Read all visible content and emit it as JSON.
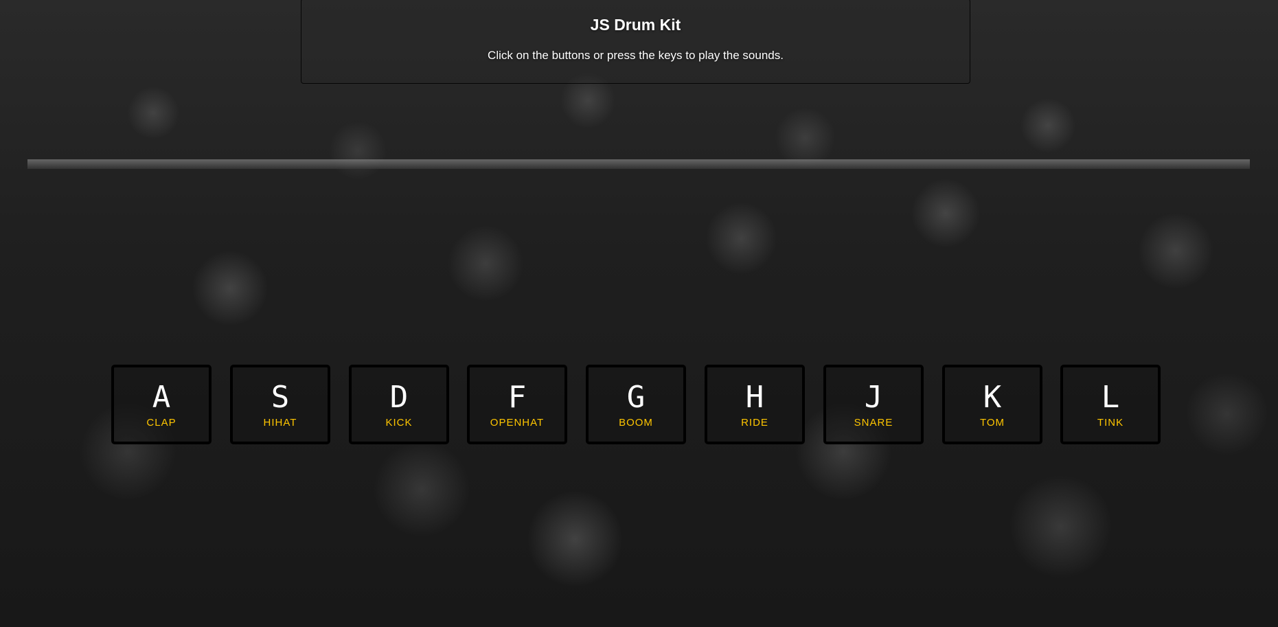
{
  "header": {
    "title": "JS Drum Kit",
    "instructions": "Click on the buttons or press the keys to play the sounds."
  },
  "accent_color": "#ffc600",
  "keys": [
    {
      "key": "A",
      "sound": "CLAP"
    },
    {
      "key": "S",
      "sound": "HIHAT"
    },
    {
      "key": "D",
      "sound": "KICK"
    },
    {
      "key": "F",
      "sound": "OPENHAT"
    },
    {
      "key": "G",
      "sound": "BOOM"
    },
    {
      "key": "H",
      "sound": "RIDE"
    },
    {
      "key": "J",
      "sound": "SNARE"
    },
    {
      "key": "K",
      "sound": "TOM"
    },
    {
      "key": "L",
      "sound": "TINK"
    }
  ]
}
